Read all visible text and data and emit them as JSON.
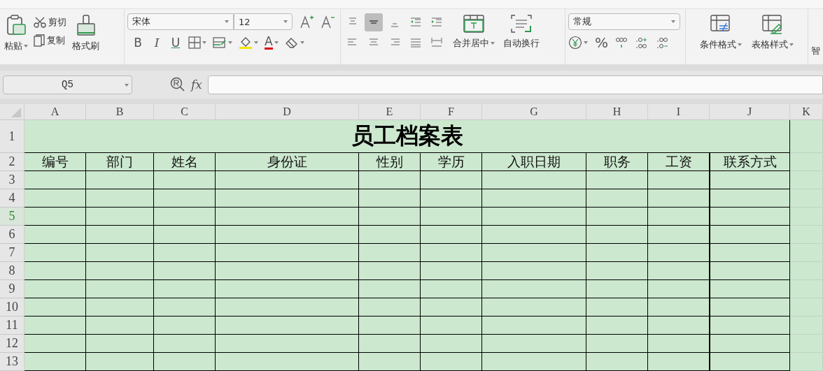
{
  "ribbon": {
    "clipboard": {
      "paste": "粘贴",
      "cut": "剪切",
      "copy": "复制",
      "painter": "格式刷"
    },
    "font": {
      "name": "宋体",
      "size": "12",
      "styles": [
        "B",
        "I",
        "U"
      ],
      "color_letter": "A"
    },
    "alignment": [
      {
        "selected": false
      },
      {
        "selected": true
      },
      {
        "selected": false
      },
      {
        "selected": false
      },
      {
        "selected": false
      },
      {
        "selected": false
      },
      {
        "selected": false
      },
      {
        "selected": false
      },
      {
        "selected": false
      },
      {
        "selected": false
      }
    ],
    "merge": "合并居中",
    "wrap": "自动换行",
    "number": {
      "format": "常规",
      "percent": "%"
    },
    "styles": [
      "条件格式",
      "表格样式"
    ],
    "cut_off_label": "智"
  },
  "formula_bar": {
    "name_box": "Q5",
    "fx": "fx"
  },
  "sheet": {
    "columns": [
      {
        "label": "A"
      },
      {
        "label": "B"
      },
      {
        "label": "C"
      },
      {
        "label": "D"
      },
      {
        "label": "E"
      },
      {
        "label": "F"
      },
      {
        "label": "G"
      },
      {
        "label": "H"
      },
      {
        "label": "I"
      },
      {
        "label": "J"
      },
      {
        "label": "K"
      }
    ],
    "rows": [
      {
        "label": "1",
        "selected": false
      },
      {
        "label": "2",
        "selected": false
      },
      {
        "label": "3",
        "selected": false
      },
      {
        "label": "4",
        "selected": false
      },
      {
        "label": "5",
        "selected": true
      },
      {
        "label": "6",
        "selected": false
      },
      {
        "label": "7",
        "selected": false
      },
      {
        "label": "8",
        "selected": false
      },
      {
        "label": "9",
        "selected": false
      },
      {
        "label": "10",
        "selected": false
      },
      {
        "label": "11",
        "selected": false
      },
      {
        "label": "12",
        "selected": false
      },
      {
        "label": "13",
        "selected": false
      }
    ],
    "title": "员工档案表",
    "headers": [
      "编号",
      "部门",
      "姓名",
      "身份证",
      "性别",
      "学历",
      "入职日期",
      "职务",
      "工资",
      "联系方式"
    ]
  }
}
